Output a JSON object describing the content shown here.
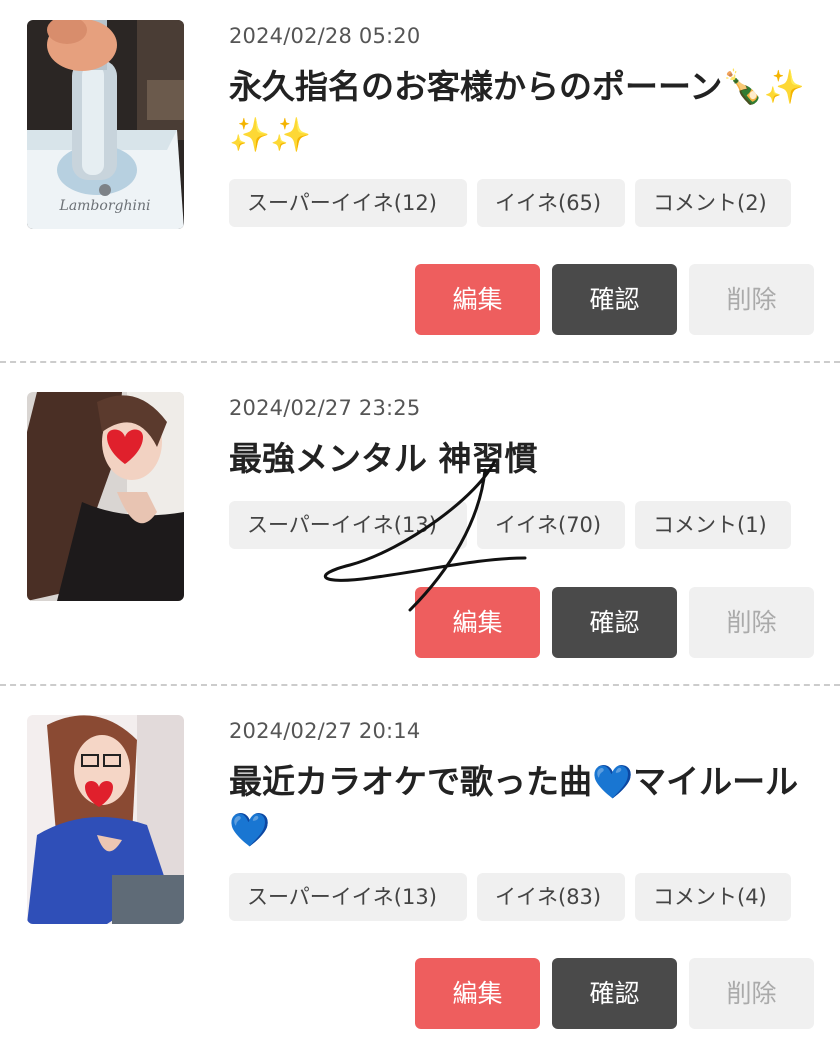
{
  "posts": [
    {
      "date": "2024/02/28 05:20",
      "title": "永久指名のお客様からのポーーン🍾✨✨✨",
      "super_like": "スーパーイイネ(12)",
      "like": "イイネ(65)",
      "comment": "コメント(2)",
      "thumb_logo_text": "Lamborghini"
    },
    {
      "date": "2024/02/27 23:25",
      "title": "最強メンタル 神習慣",
      "super_like": "スーパーイイネ(13)",
      "like": "イイネ(70)",
      "comment": "コメント(1)"
    },
    {
      "date": "2024/02/27 20:14",
      "title": "最近カラオケで歌った曲💙マイルール💙",
      "super_like": "スーパーイイネ(13)",
      "like": "イイネ(83)",
      "comment": "コメント(4)"
    }
  ],
  "buttons": {
    "edit": "編集",
    "confirm": "確認",
    "delete": "削除"
  },
  "colors": {
    "edit": "#ee5e5e",
    "confirm": "#4a4a4a",
    "delete_bg": "#f0f0f0",
    "chip_bg": "#f0f0f0"
  }
}
